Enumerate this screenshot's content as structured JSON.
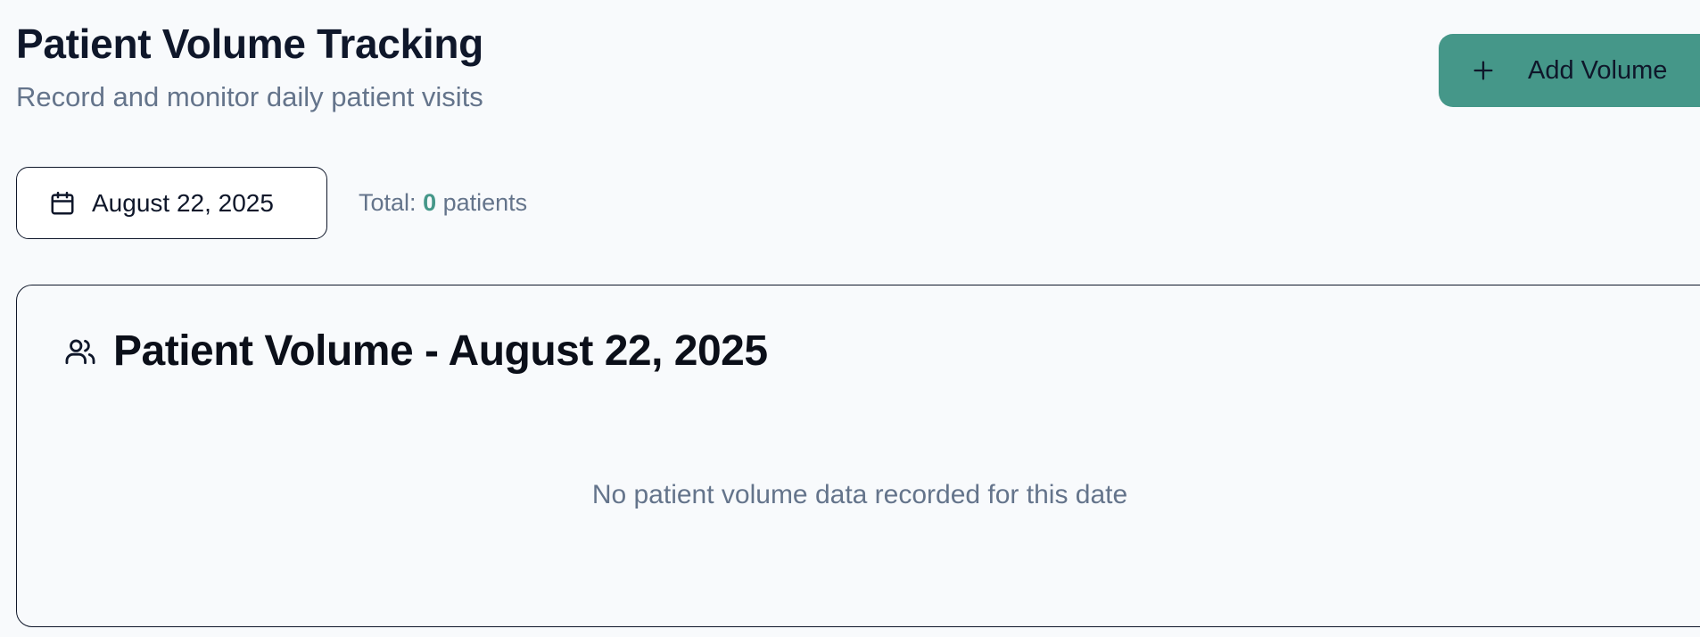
{
  "header": {
    "title": "Patient Volume Tracking",
    "subtitle": "Record and monitor daily patient visits",
    "add_button": {
      "icon": "plus-icon",
      "label": "Add Volume"
    }
  },
  "controls": {
    "date_picker": {
      "icon": "calendar-icon",
      "value": "August 22, 2025"
    },
    "total": {
      "prefix": "Total:",
      "count": "0",
      "suffix": "patients"
    }
  },
  "card": {
    "icon": "users-icon",
    "title": "Patient Volume - August 22, 2025",
    "empty_message": "No patient volume data recorded for this date"
  },
  "colors": {
    "accent": "#459789",
    "text_primary": "#0f172a",
    "text_muted": "#64748b",
    "background": "#f8fafc"
  }
}
